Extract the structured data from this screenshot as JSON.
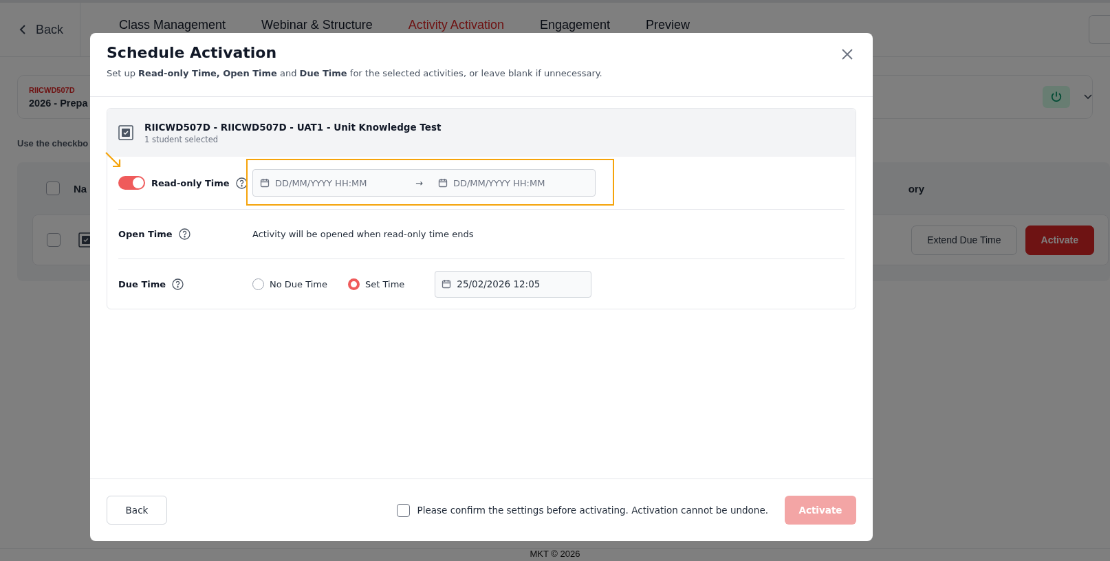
{
  "top_nav": {
    "back": "Back",
    "tabs": [
      {
        "label": "Class Management",
        "selected": false
      },
      {
        "label": "Webinar & Structure",
        "selected": false
      },
      {
        "label": "Activity Activation",
        "selected": true
      },
      {
        "label": "Engagement",
        "selected": false
      },
      {
        "label": "Preview",
        "selected": false
      }
    ]
  },
  "course": {
    "code": "RIICWD507D",
    "title": "2026 - Prepa"
  },
  "instructions": "Use the checkbo",
  "table": {
    "columns": [
      "Na",
      "ory"
    ],
    "header_checked": false,
    "rows": [
      {
        "checked": false,
        "actions": [
          "Extend Due Time",
          "Activate"
        ]
      }
    ]
  },
  "footer": "MKT © 2026",
  "dialog": {
    "title": "Schedule Activation",
    "subtitle": "Set up **Read-only Time, Open Time** and **Due Time** for the selected activities, or leave blank if unnecessary.",
    "activity": {
      "title": "RIICWD507D - RIICWD507D - UAT1 - Unit Knowledge Test",
      "subtitle": "1 student selected"
    },
    "read_only": {
      "label": "Read-only Time",
      "on": true,
      "start_placeholder": "DD/MM/YYYY HH:MM",
      "arrow": "→",
      "end_placeholder": "DD/MM/YYYY HH:MM"
    },
    "open_time": {
      "label": "Open Time",
      "text": "Activity will be opened when read-only time ends"
    },
    "due_time": {
      "label": "Due Time",
      "options": [
        {
          "label": "No Due Time",
          "selected": false
        },
        {
          "label": "Set Time",
          "selected": true
        }
      ],
      "value": "25/02/2026 12:05"
    },
    "back": "Back",
    "confirm": {
      "text": "Please confirm the settings before activating. Activation cannot be undone.",
      "checked": false
    },
    "activate": {
      "label": "Activate",
      "disabled": true
    }
  },
  "annotations": {
    "arrow": true,
    "highlight": true
  }
}
